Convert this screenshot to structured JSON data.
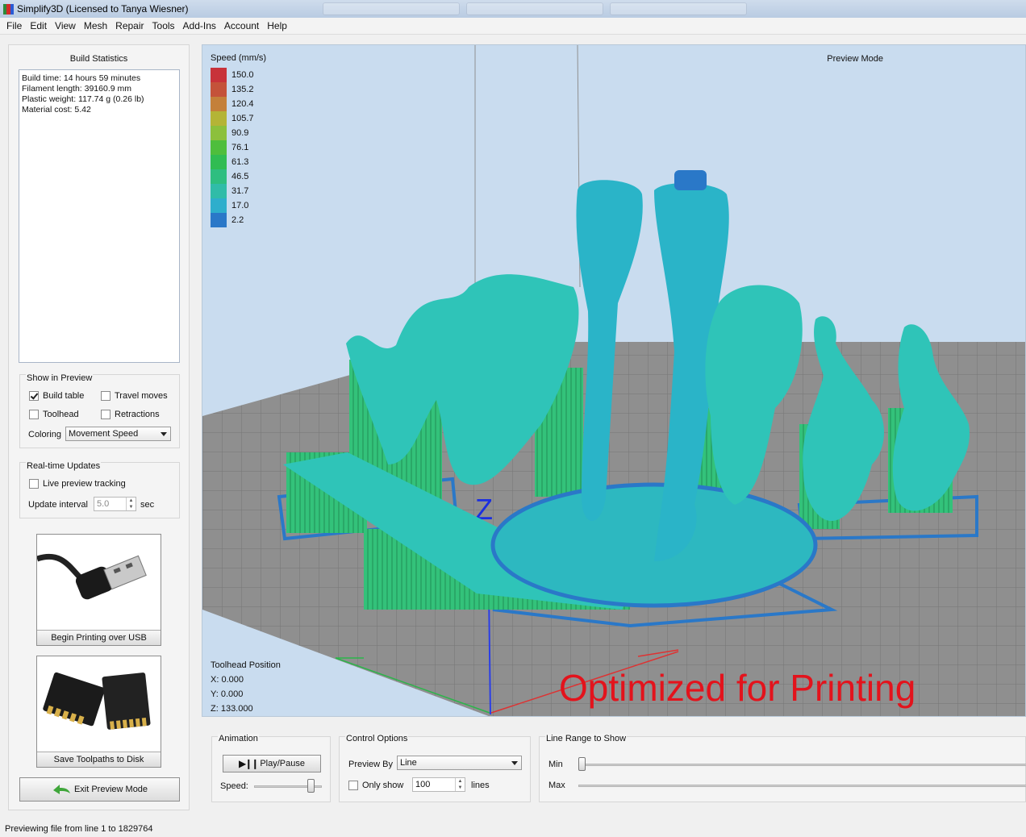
{
  "window": {
    "title": "Simplify3D (Licensed to Tanya Wiesner)"
  },
  "menu": [
    "File",
    "Edit",
    "View",
    "Mesh",
    "Repair",
    "Tools",
    "Add-Ins",
    "Account",
    "Help"
  ],
  "build_stats": {
    "title": "Build Statistics",
    "lines": [
      "Build time: 14 hours 59 minutes",
      "Filament length: 39160.9 mm",
      "Plastic weight: 117.74 g (0.26 lb)",
      "Material cost: 5.42"
    ]
  },
  "show_in_preview": {
    "title": "Show in Preview",
    "build_table": {
      "label": "Build table",
      "checked": true
    },
    "travel_moves": {
      "label": "Travel moves",
      "checked": false
    },
    "toolhead": {
      "label": "Toolhead",
      "checked": false
    },
    "retractions": {
      "label": "Retractions",
      "checked": false
    },
    "coloring_label": "Coloring",
    "coloring_value": "Movement Speed"
  },
  "realtime": {
    "title": "Real-time Updates",
    "live_tracking": {
      "label": "Live preview tracking",
      "checked": false
    },
    "interval_label": "Update interval",
    "interval_value": "5.0",
    "interval_unit": "sec"
  },
  "usb_button": {
    "label": "Begin Printing over USB"
  },
  "disk_button": {
    "label": "Save Toolpaths to Disk"
  },
  "exit_button": {
    "label": "Exit Preview Mode"
  },
  "viewport": {
    "legend_title": "Speed (mm/s)",
    "legend": [
      {
        "value": "150.0",
        "color": "#c8323a"
      },
      {
        "value": "135.2",
        "color": "#c4523a"
      },
      {
        "value": "120.4",
        "color": "#c4803a"
      },
      {
        "value": "105.7",
        "color": "#b4b436"
      },
      {
        "value": "90.9",
        "color": "#8cc03c"
      },
      {
        "value": "76.1",
        "color": "#4ebe3c"
      },
      {
        "value": "61.3",
        "color": "#30bc52"
      },
      {
        "value": "46.5",
        "color": "#2ebe80"
      },
      {
        "value": "31.7",
        "color": "#30bca8"
      },
      {
        "value": "17.0",
        "color": "#2eaecc"
      },
      {
        "value": "2.2",
        "color": "#2a78c8"
      }
    ],
    "mode": "Preview Mode",
    "toolhead_title": "Toolhead Position",
    "x": "X: 0.000",
    "y": "Y: 0.000",
    "z": "Z: 133.000",
    "axis_z_label": "Z",
    "annotation": "Optimized for Printing"
  },
  "animation": {
    "title": "Animation",
    "play_label": "Play/Pause",
    "speed_label": "Speed:",
    "speed_level": 0.85
  },
  "control_options": {
    "title": "Control Options",
    "preview_by_label": "Preview By",
    "preview_by_value": "Line",
    "only_show": {
      "label": "Only show",
      "checked": false
    },
    "only_show_value": "100",
    "only_show_unit": "lines"
  },
  "line_range": {
    "title": "Line Range to Show",
    "min_label": "Min",
    "max_label": "Max",
    "min_level": 0.0,
    "max_level": 1.0
  },
  "status": "Previewing file from line 1 to 1829764"
}
